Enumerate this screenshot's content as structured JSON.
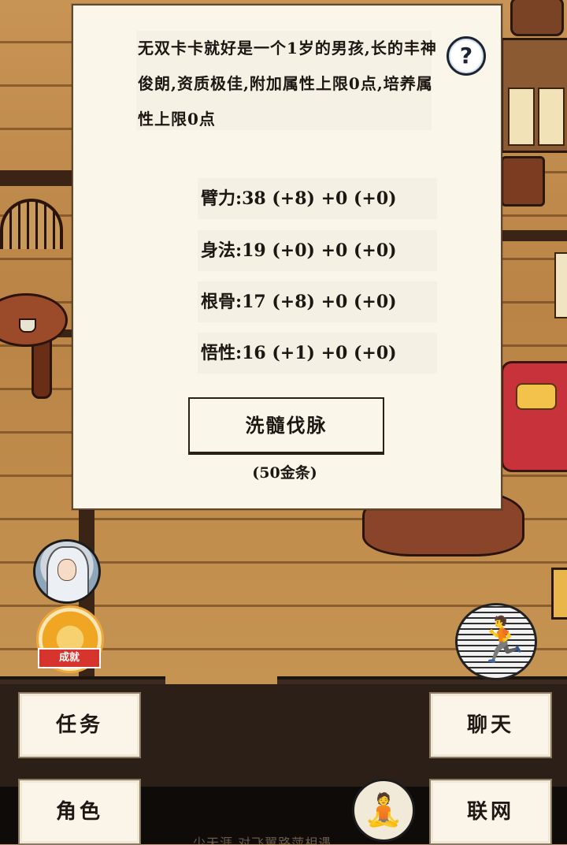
{
  "dialog": {
    "intro": "无双卡卡就好是一个1岁的男孩,长的丰神俊朗,资质极佳,附加属性上限0点,培养属性上限0点",
    "help_icon": "question-mark-icon",
    "stats": [
      {
        "text": "臂力:38 (+8) +0 (+0)"
      },
      {
        "text": "身法:19 (+0) +0 (+0)"
      },
      {
        "text": "根骨:17 (+8) +0 (+0)"
      },
      {
        "text": "悟性:16 (+1) +0 (+0)"
      }
    ],
    "refine_label": "洗髓伐脉",
    "cost": "(50金条)"
  },
  "side": {
    "achievement_label": "成就",
    "avatar_icon": "character-portrait-icon",
    "run_icon": "running-figure-icon",
    "meditate_icon": "meditation-icon"
  },
  "menu": {
    "task": "任务",
    "role": "角色",
    "chat": "聊天",
    "network": "联网"
  },
  "footer_text": "少天涯 对飞翼路萍相遇"
}
